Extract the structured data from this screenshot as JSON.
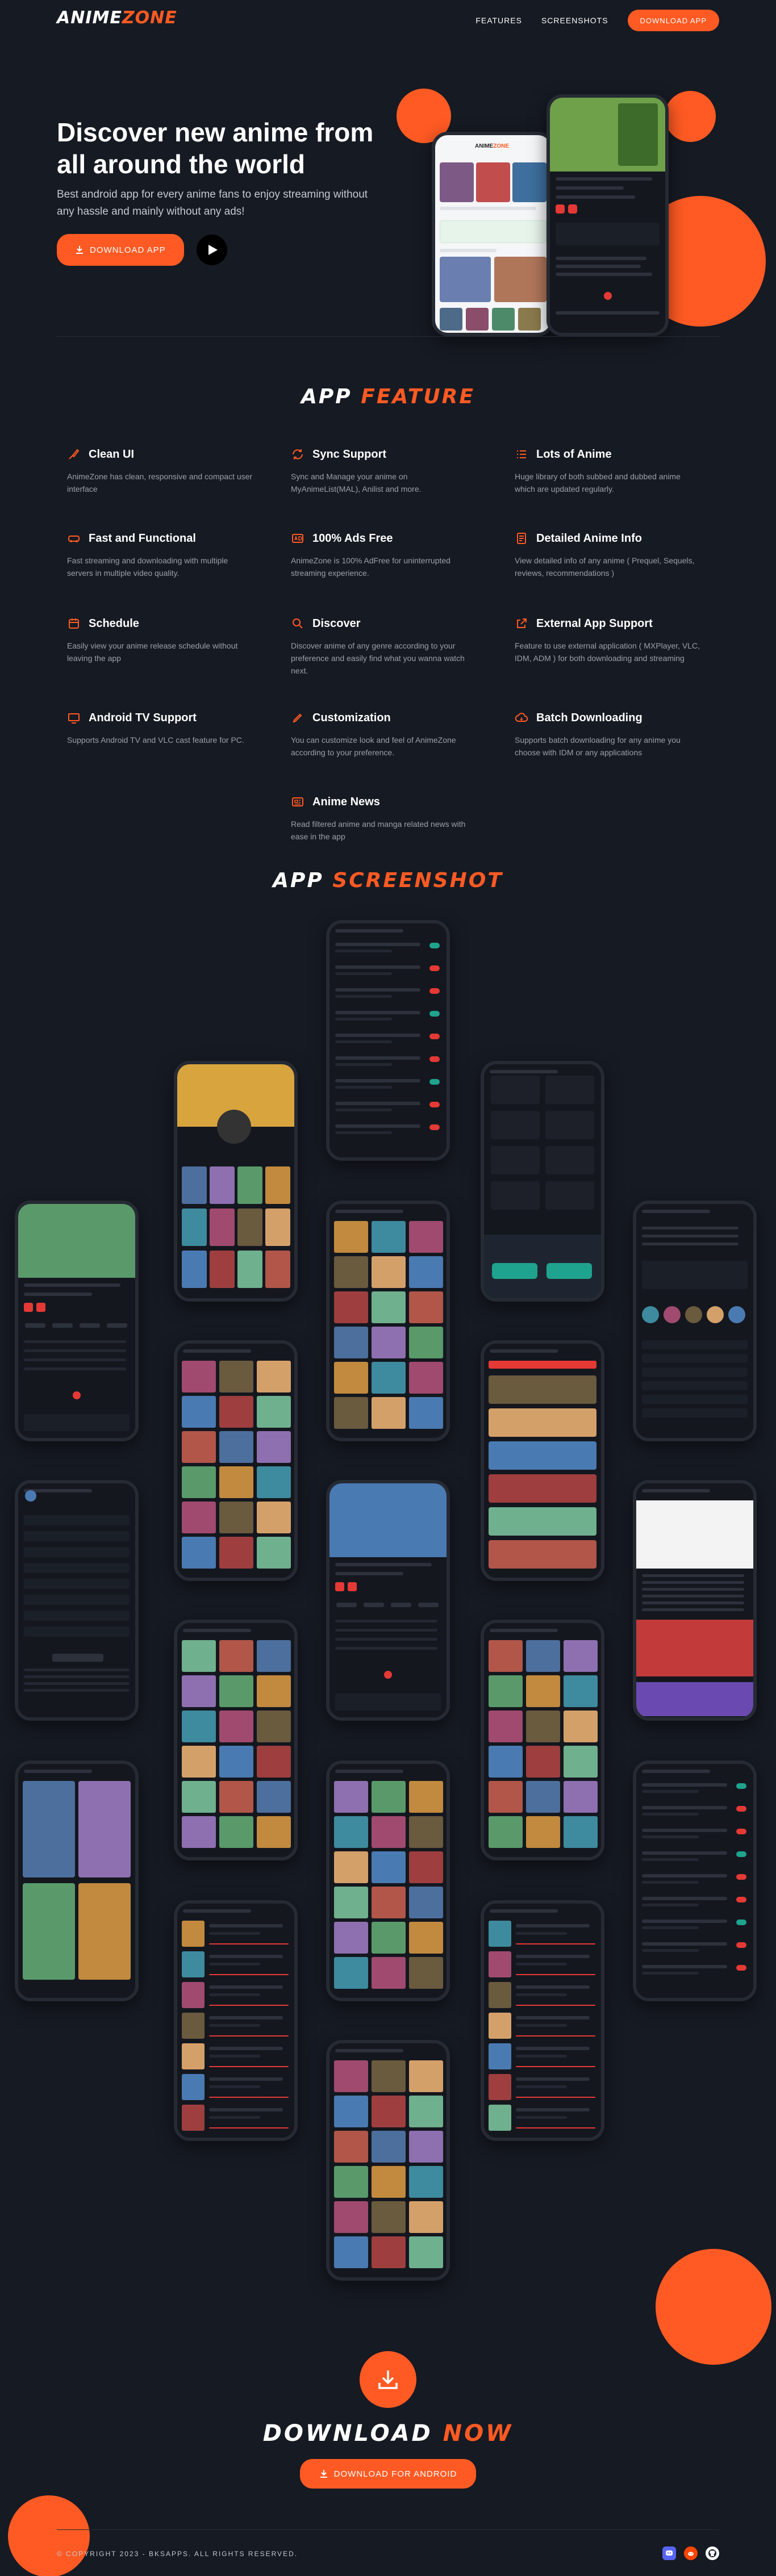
{
  "nav": {
    "logo_a": "ANIME",
    "logo_b": "ZONE",
    "features": "FEATURES",
    "screenshots": "SCREENSHOTS",
    "download": "DOWNLOAD APP"
  },
  "hero": {
    "title": "Discover new anime from all around the world",
    "subtitle": "Best android app for every anime fans to enjoy streaming without any hassle and mainly without any ads!",
    "download": "DOWNLOAD APP"
  },
  "features": {
    "title_a": "APP",
    "title_b": "FEATURE",
    "items": [
      {
        "name": "Clean UI",
        "desc": "AnimeZone has clean, responsive and compact user interface",
        "icon": "brush-icon"
      },
      {
        "name": "Sync Support",
        "desc": "Sync and Manage your anime on MyAnimeList(MAL), Anilist and more.",
        "icon": "sync-icon"
      },
      {
        "name": "Lots of Anime",
        "desc": "Huge library of both subbed and dubbed anime which are updated regularly.",
        "icon": "list-icon"
      },
      {
        "name": "Fast and Functional",
        "desc": "Fast streaming and downloading with multiple servers in multiple video quality.",
        "icon": "car-icon"
      },
      {
        "name": "100% Ads Free",
        "desc": "AnimeZone is 100% AdFree for uninterrupted streaming experience.",
        "icon": "ad-icon"
      },
      {
        "name": "Detailed Anime Info",
        "desc": "View detailed info of any anime ( Prequel, Sequels, reviews, recommendations )",
        "icon": "document-icon"
      },
      {
        "name": "Schedule",
        "desc": "Easily view your anime release schedule without leaving the app",
        "icon": "calendar-icon"
      },
      {
        "name": "Discover",
        "desc": "Discover anime of any genre according to your preference and easily find what you wanna watch next.",
        "icon": "search-icon"
      },
      {
        "name": "External App Support",
        "desc": "Feature to use external application ( MXPlayer, VLC, IDM, ADM ) for both downloading and streaming",
        "icon": "external-icon"
      },
      {
        "name": "Android TV Support",
        "desc": "Supports Android TV and VLC cast feature for PC.",
        "icon": "tv-icon"
      },
      {
        "name": "Customization",
        "desc": "You can customize look and feel of AnimeZone according to your preference.",
        "icon": "pen-icon"
      },
      {
        "name": "Batch Downloading",
        "desc": "Supports batch downloading for any anime you choose with IDM or any applications",
        "icon": "cloud-icon"
      },
      {
        "name": "Anime News",
        "desc": "Read filtered anime and manga related news with ease in the app",
        "icon": "news-icon"
      }
    ]
  },
  "screenshots": {
    "title_a": "APP",
    "title_b": "SCREENSHOT"
  },
  "download": {
    "title_a": "DOWNLOAD",
    "title_b": "NOW",
    "button": "DOWNLOAD FOR ANDROID"
  },
  "footer": {
    "copyright": "© COPYRIGHT 2023 - BKSAPPS. ALL RIGHTS RESERVED."
  },
  "colors": {
    "accent": "#ff5a23",
    "background": "#161a22"
  }
}
